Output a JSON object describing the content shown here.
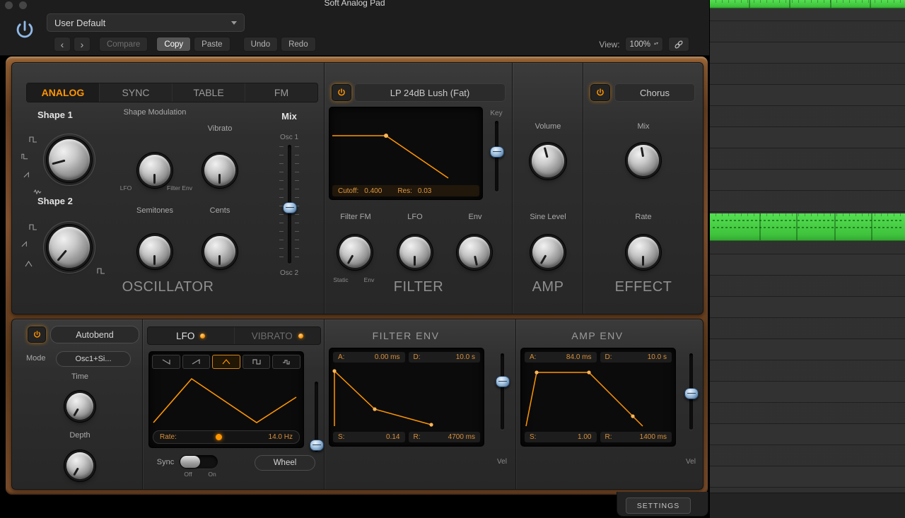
{
  "header": {
    "title": "Soft Analog Pad",
    "preset": "User Default",
    "back": "‹",
    "forward": "›",
    "compare": "Compare",
    "copy": "Copy",
    "paste": "Paste",
    "undo": "Undo",
    "redo": "Redo",
    "view_label": "View:",
    "view_value": "100%"
  },
  "osc": {
    "tabs": [
      "ANALOG",
      "SYNC",
      "TABLE",
      "FM"
    ],
    "active_tab": "ANALOG",
    "shape1": "Shape 1",
    "shape2": "Shape 2",
    "shape_mod": "Shape Modulation",
    "shape_mod_min": "LFO",
    "shape_mod_max": "Filter Env",
    "vibrato": "Vibrato",
    "semitones": "Semitones",
    "cents": "Cents",
    "mix": "Mix",
    "osc1": "Osc 1",
    "osc2": "Osc 2",
    "title": "OSCILLATOR"
  },
  "filter": {
    "preset": "LP 24dB Lush (Fat)",
    "key": "Key",
    "cutoff_label": "Cutoff:",
    "cutoff": "0.400",
    "res_label": "Res:",
    "res": "0.03",
    "fm": "Filter FM",
    "static": "Static",
    "env_small": "Env",
    "lfo": "LFO",
    "env": "Env",
    "title": "FILTER"
  },
  "amp": {
    "volume": "Volume",
    "sine": "Sine Level",
    "title": "AMP"
  },
  "effect": {
    "preset": "Chorus",
    "mix": "Mix",
    "rate": "Rate",
    "title": "EFFECT"
  },
  "autobend": {
    "label": "Autobend",
    "mode": "Mode",
    "mode_value": "Osc1+Si...",
    "time": "Time",
    "depth": "Depth"
  },
  "lfo": {
    "tab_lfo": "LFO",
    "tab_vibrato": "VIBRATO",
    "rate_label": "Rate:",
    "rate_value": "14.0 Hz",
    "sync": "Sync",
    "off": "Off",
    "on": "On",
    "wheel": "Wheel"
  },
  "fenv": {
    "title": "FILTER ENV",
    "a_label": "A:",
    "a": "0.00 ms",
    "d_label": "D:",
    "d": "10.0 s",
    "s_label": "S:",
    "s": "0.14",
    "r_label": "R:",
    "r": "4700 ms",
    "vel": "Vel"
  },
  "aenv": {
    "title": "AMP ENV",
    "a_label": "A:",
    "a": "84.0 ms",
    "d_label": "D:",
    "d": "10.0 s",
    "s_label": "S:",
    "s": "1.00",
    "r_label": "R:",
    "r": "1400 ms",
    "vel": "Vel"
  },
  "settings": "SETTINGS",
  "colors": {
    "accent": "#ff9500",
    "note_green": "#45cf45",
    "slider_blue": "#8fb4d8"
  }
}
